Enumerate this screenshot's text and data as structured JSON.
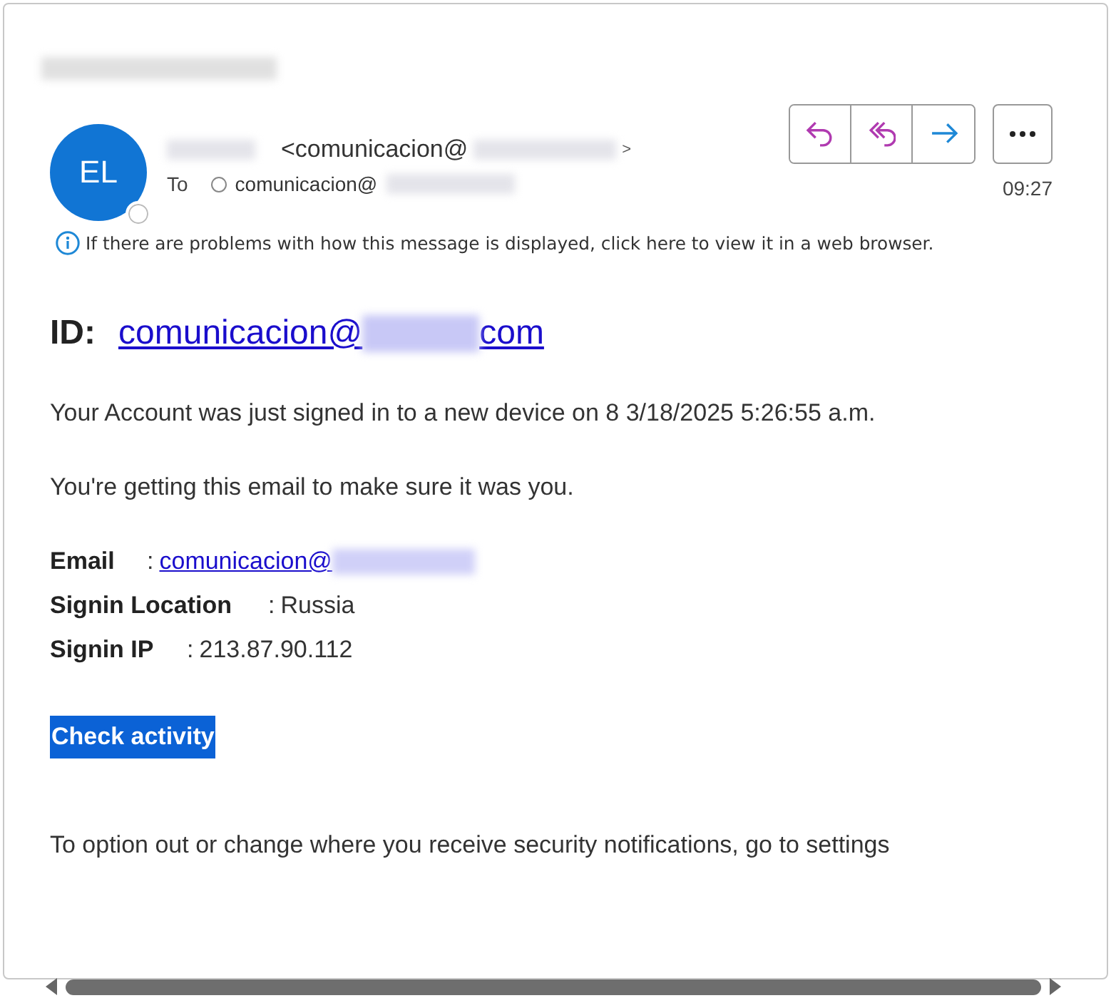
{
  "header": {
    "avatar": "EL",
    "sender": "<comunicacion@",
    "sender_end": ">",
    "to_label": "To",
    "recipient": "comunicacion@",
    "time": "09:27",
    "actions": [
      {
        "kind": "reply"
      },
      {
        "kind": "reply_all"
      },
      {
        "kind": "forward"
      },
      {
        "kind": "more"
      }
    ],
    "info": "If there are problems with how this message is displayed, click here to view it in a web browser."
  },
  "body": {
    "id_label": "ID:",
    "id_link_start": "comunicacion@",
    "id_link_end": "com",
    "paragraphs": [
      "Your Account was just signed in to a new device on 8 3/18/2025 5:26:55 a.m.",
      "You're getting this email to make sure it was you."
    ],
    "details": [
      {
        "label": "Email",
        "separator": ":",
        "value": "comunicacion@",
        "kind": "link"
      },
      {
        "label": "Signin Location",
        "separator": ":",
        "value": "Russia",
        "kind": "text"
      },
      {
        "label": "Signin IP",
        "separator": ":",
        "value": "213.87.90.112",
        "kind": "text"
      }
    ],
    "action": "Check activity",
    "footer": "To option out or change where you receive security notifications, go to settings"
  }
}
